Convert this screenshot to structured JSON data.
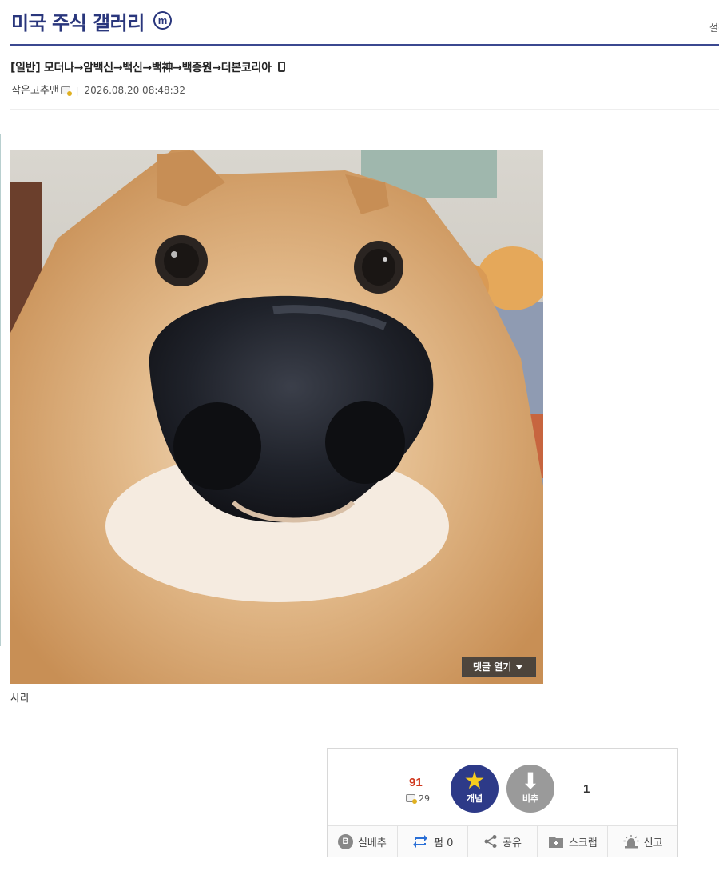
{
  "header": {
    "gallery_title": "미국 주식 갤러리",
    "minor_badge": "m",
    "settings_label": "설정"
  },
  "post": {
    "title": "[일반] 모더나→암백신→백신→백神→백종원→더본코리아",
    "author": "작은고추맨",
    "date": "2026.08.20 08:48:32",
    "body_text": "사라",
    "comment_toggle_label": "댓글 열기"
  },
  "vote": {
    "up_count": "91",
    "fixed_up_count": "29",
    "up_label": "개념",
    "down_label": "비추",
    "down_count": "1"
  },
  "actions": [
    {
      "label": "실베추",
      "icon": "b-circle-icon"
    },
    {
      "label": "펌 0",
      "icon": "repost-icon"
    },
    {
      "label": "공유",
      "icon": "share-icon"
    },
    {
      "label": "스크랩",
      "icon": "folder-plus-icon"
    },
    {
      "label": "신고",
      "icon": "siren-icon"
    }
  ],
  "colors": {
    "brand_navy": "#29367c",
    "up_count_red": "#d0391f",
    "upvote_bg": "#2d3a88",
    "downvote_bg": "#9a9a9a",
    "star_yellow": "#f6cc1d"
  }
}
